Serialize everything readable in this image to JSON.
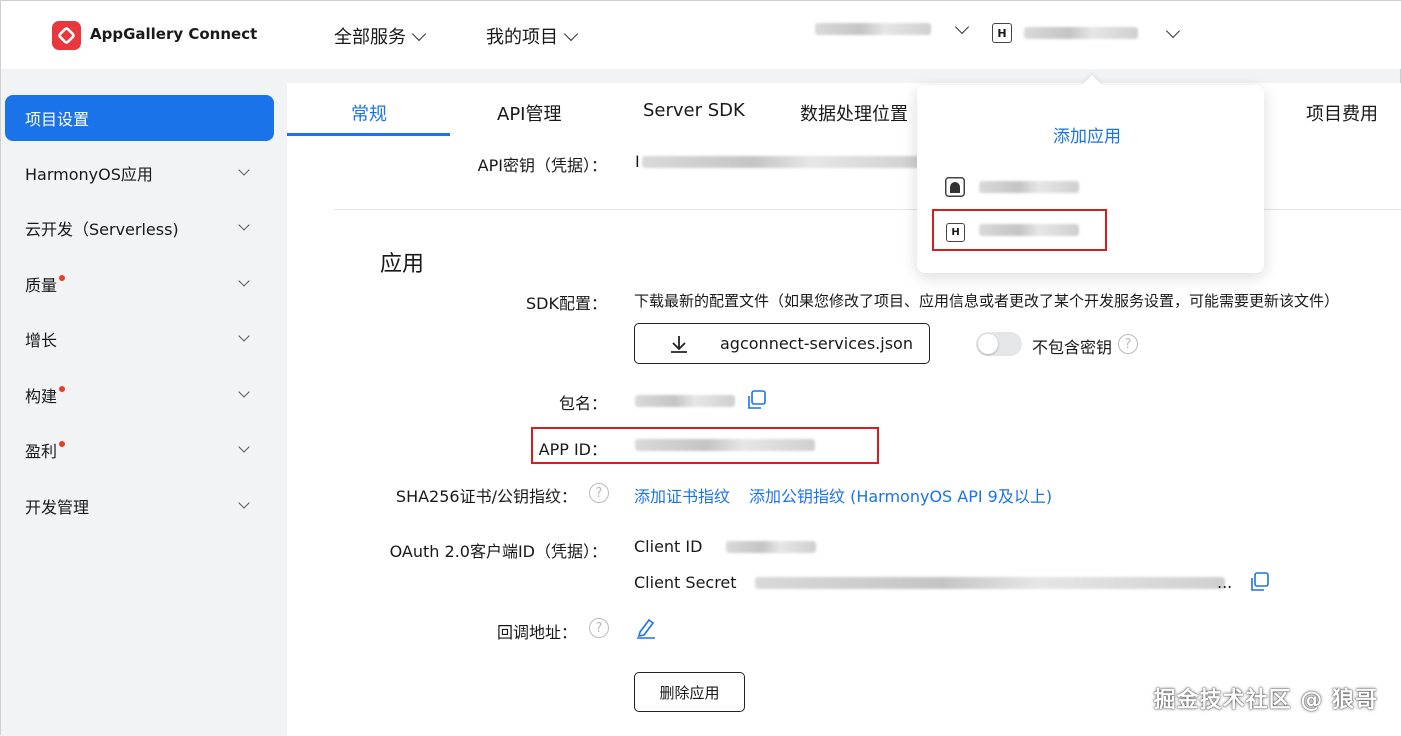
{
  "header": {
    "brand": "AppGallery Connect",
    "nav": [
      "全部服务",
      "我的项目"
    ],
    "account_badge": "H"
  },
  "sidebar": {
    "items": [
      {
        "label": "项目设置",
        "active": true,
        "dot": false
      },
      {
        "label": "HarmonyOS应用",
        "dot": false
      },
      {
        "label": "云开发（Serverless)",
        "dot": false
      },
      {
        "label": "质量",
        "dot": true
      },
      {
        "label": "增长",
        "dot": false
      },
      {
        "label": "构建",
        "dot": true
      },
      {
        "label": "盈利",
        "dot": true
      },
      {
        "label": "开发管理",
        "dot": false
      }
    ]
  },
  "tabs": [
    "常规",
    "API管理",
    "Server SDK",
    "数据处理位置",
    "项目费用"
  ],
  "main": {
    "api_key_label": "API密钥（凭据）：",
    "api_key_prefix": "I",
    "section_title": "应用",
    "sdk_label": "SDK配置：",
    "sdk_desc": "下载最新的配置文件（如果您修改了项目、应用信息或者更改了某个开发服务设置，可能需要更新该文件）",
    "sdk_file": "agconnect-services.json",
    "exclude_key_label": "不包含密钥",
    "package_label": "包名：",
    "app_id_label": "APP ID：",
    "sha_label": "SHA256证书/公钥指纹：",
    "add_cert": "添加证书指纹",
    "add_pubkey": "添加公钥指纹 (HarmonyOS API 9及以上)",
    "oauth_label": "OAuth 2.0客户端ID（凭据）：",
    "client_id_label": "Client ID",
    "client_secret_label": "Client Secret",
    "client_secret_suffix": "...",
    "callback_label": "回调地址：",
    "delete_button": "删除应用"
  },
  "dropdown": {
    "add_app": "添加应用",
    "h_badge": "H"
  },
  "watermark": "掘金技术社区 @ 狼哥"
}
